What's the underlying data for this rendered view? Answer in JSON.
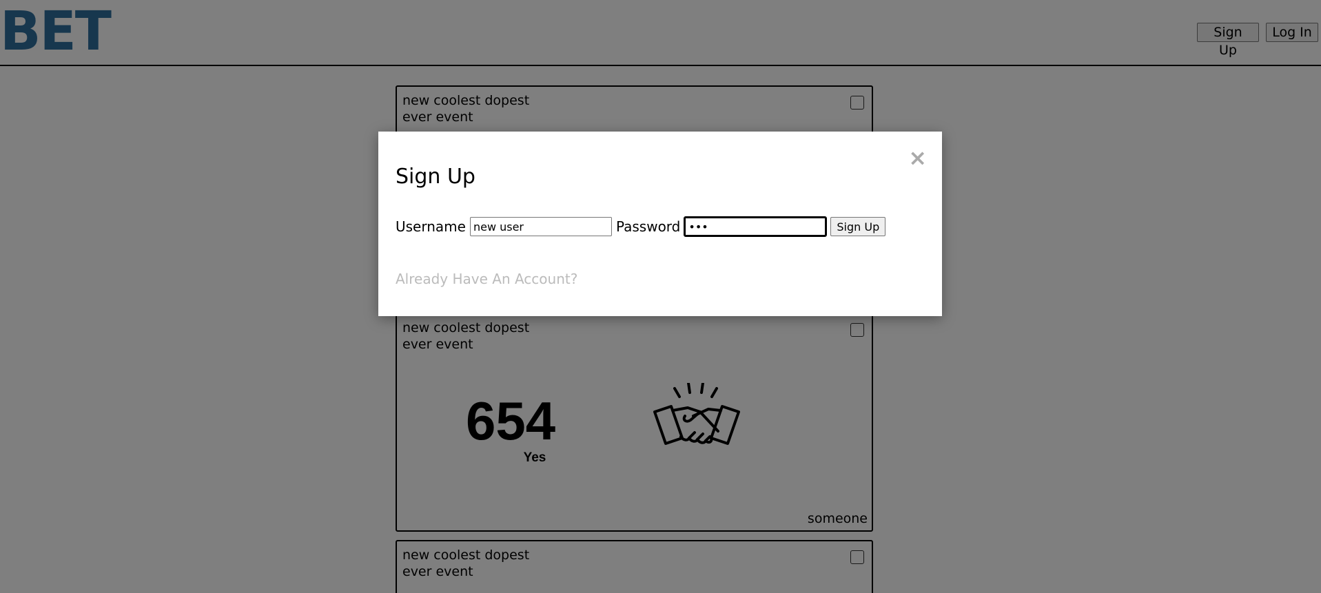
{
  "header": {
    "logo": "BET",
    "sign_up_label": "Sign Up",
    "log_in_label": "Log In"
  },
  "cards": [
    {
      "title": "new coolest dopest ever event"
    },
    {
      "title": "new coolest dopest ever event",
      "count": "654",
      "count_label": "Yes",
      "owner": "someone"
    },
    {
      "title": "new coolest dopest ever event"
    }
  ],
  "modal": {
    "title": "Sign Up",
    "close_glyph": "×",
    "username_label": "Username",
    "username_value": "new user",
    "password_label": "Password",
    "password_value": "•••",
    "submit_label": "Sign Up",
    "link_text": "Already Have An Account?"
  },
  "colors": {
    "logo": "#2f6f9d",
    "overlay": "rgba(0,0,0,0.5)",
    "link": "#bbbbbb"
  },
  "icons": {
    "handshake": "handshake-icon",
    "close": "close-icon"
  }
}
